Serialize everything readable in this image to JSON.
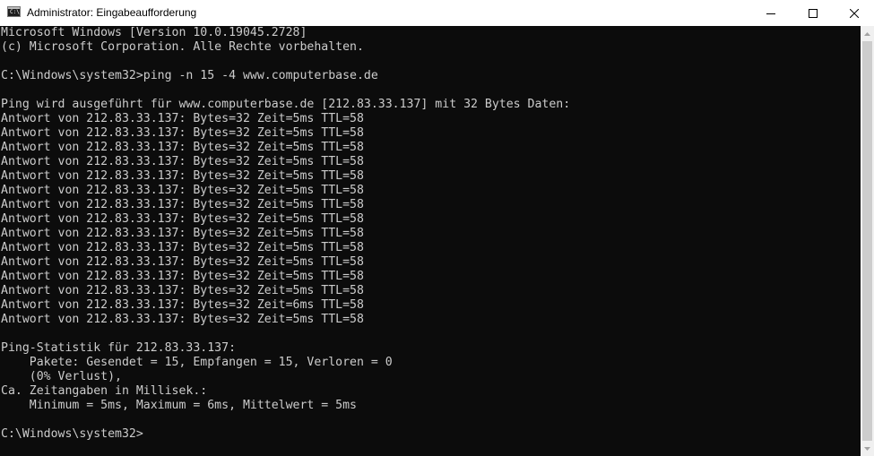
{
  "window": {
    "title": "Administrator: Eingabeaufforderung",
    "app_icon": "console-icon",
    "app_icon_text": "C:\\",
    "controls": {
      "minimize": "minimize-icon",
      "maximize": "maximize-icon",
      "close": "close-icon"
    }
  },
  "console": {
    "lines": [
      "Microsoft Windows [Version 10.0.19045.2728]",
      "(c) Microsoft Corporation. Alle Rechte vorbehalten.",
      "",
      "C:\\Windows\\system32>ping -n 15 -4 www.computerbase.de",
      "",
      "Ping wird ausgeführt für www.computerbase.de [212.83.33.137] mit 32 Bytes Daten:",
      "Antwort von 212.83.33.137: Bytes=32 Zeit=5ms TTL=58",
      "Antwort von 212.83.33.137: Bytes=32 Zeit=5ms TTL=58",
      "Antwort von 212.83.33.137: Bytes=32 Zeit=5ms TTL=58",
      "Antwort von 212.83.33.137: Bytes=32 Zeit=5ms TTL=58",
      "Antwort von 212.83.33.137: Bytes=32 Zeit=5ms TTL=58",
      "Antwort von 212.83.33.137: Bytes=32 Zeit=5ms TTL=58",
      "Antwort von 212.83.33.137: Bytes=32 Zeit=5ms TTL=58",
      "Antwort von 212.83.33.137: Bytes=32 Zeit=5ms TTL=58",
      "Antwort von 212.83.33.137: Bytes=32 Zeit=5ms TTL=58",
      "Antwort von 212.83.33.137: Bytes=32 Zeit=5ms TTL=58",
      "Antwort von 212.83.33.137: Bytes=32 Zeit=5ms TTL=58",
      "Antwort von 212.83.33.137: Bytes=32 Zeit=5ms TTL=58",
      "Antwort von 212.83.33.137: Bytes=32 Zeit=5ms TTL=58",
      "Antwort von 212.83.33.137: Bytes=32 Zeit=6ms TTL=58",
      "Antwort von 212.83.33.137: Bytes=32 Zeit=5ms TTL=58",
      "",
      "Ping-Statistik für 212.83.33.137:",
      "    Pakete: Gesendet = 15, Empfangen = 15, Verloren = 0",
      "    (0% Verlust),",
      "Ca. Zeitangaben in Millisek.:",
      "    Minimum = 5ms, Maximum = 6ms, Mittelwert = 5ms",
      "",
      "C:\\Windows\\system32>"
    ]
  },
  "colors": {
    "titlebar_bg": "#ffffff",
    "console_bg": "#0c0c0c",
    "console_text": "#cccccc",
    "scrollbar_track": "#f0f0f0",
    "scrollbar_thumb": "#cdcdcd"
  }
}
